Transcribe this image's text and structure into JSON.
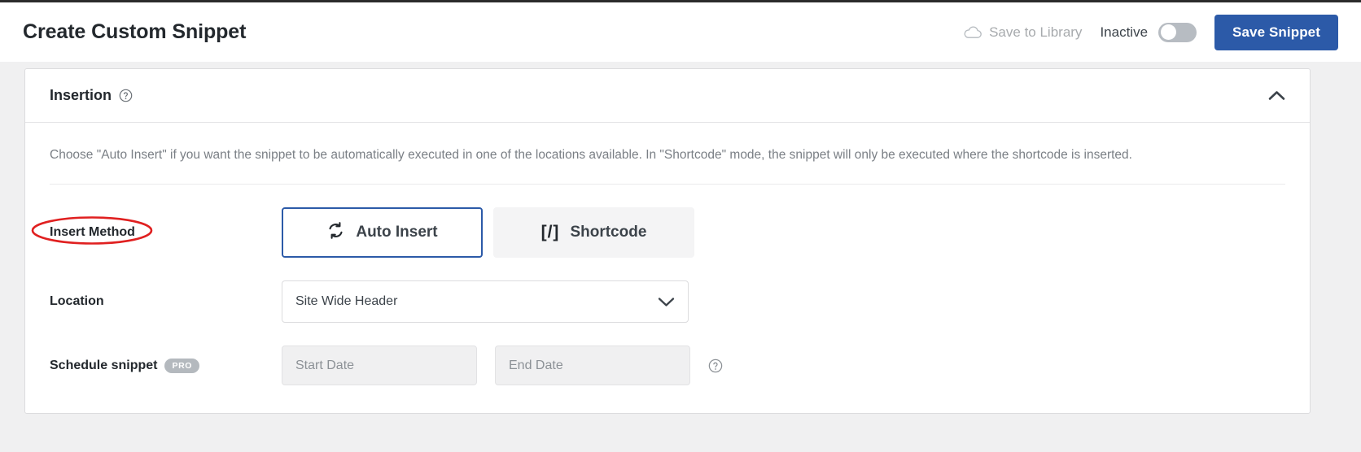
{
  "header": {
    "title": "Create Custom Snippet",
    "save_to_library_label": "Save to Library",
    "save_to_library_icon": "cloud-icon",
    "status_label": "Inactive",
    "toggle_state": "off",
    "save_button_label": "Save Snippet",
    "accent_color": "#2c5aa8",
    "muted_color": "#a7aaad"
  },
  "panel": {
    "title": "Insertion",
    "title_help_icon": "question-circle-icon",
    "collapse_icon": "chevron-up-icon",
    "description": "Choose \"Auto Insert\" if you want the snippet to be automatically executed in one of the locations available. In \"Shortcode\" mode, the snippet will only be executed where the shortcode is inserted.",
    "rows": {
      "insert_method": {
        "label": "Insert Method",
        "annotation": "red-ellipse-highlight",
        "annotation_color": "#e02020",
        "options": [
          {
            "label": "Auto Insert",
            "icon": "sync-arrows-icon",
            "selected": true
          },
          {
            "label": "Shortcode",
            "icon": "square-brackets-slash-icon",
            "selected": false
          }
        ]
      },
      "location": {
        "label": "Location",
        "selected_value": "Site Wide Header",
        "chevron_icon": "chevron-down-icon"
      },
      "schedule": {
        "label": "Schedule snippet",
        "badge": "PRO",
        "start_date_placeholder": "Start Date",
        "start_date_value": "",
        "end_date_placeholder": "End Date",
        "end_date_value": "",
        "help_icon": "question-circle-icon"
      }
    }
  }
}
